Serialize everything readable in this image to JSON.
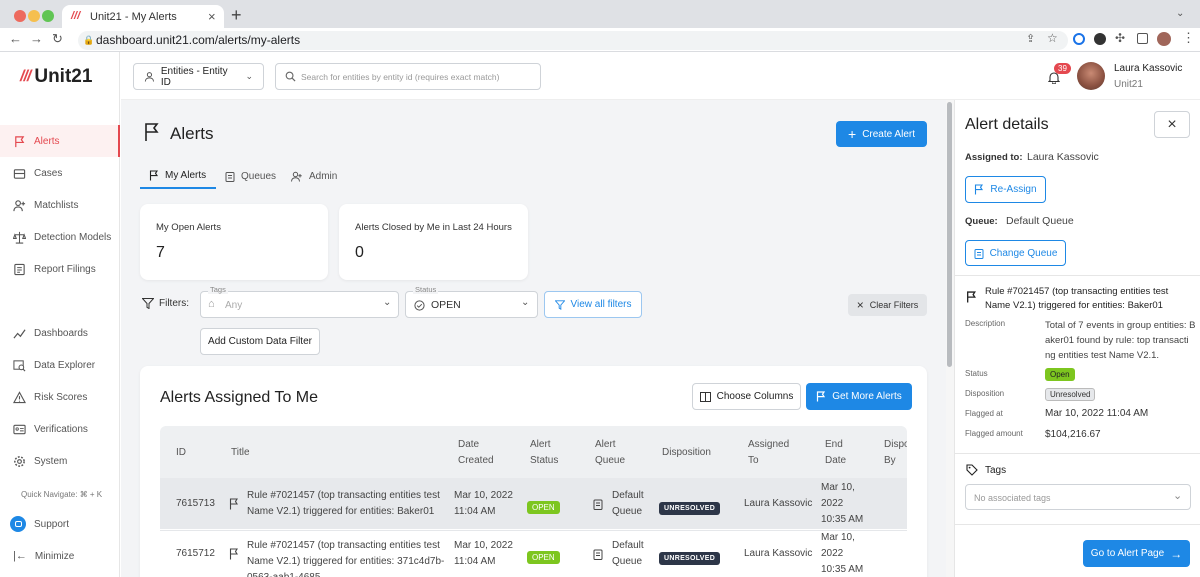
{
  "browser": {
    "tab_title": "Unit21 - My Alerts",
    "url": "dashboard.unit21.com/alerts/my-alerts",
    "colors": {
      "close": "#ed6a5e",
      "minimize": "#f5bf4f",
      "maximize": "#61c554"
    }
  },
  "brand": {
    "name": "Unit21",
    "accent": "#e4484f"
  },
  "sidebar": {
    "items": [
      {
        "label": "Alerts",
        "icon": "flag-icon"
      },
      {
        "label": "Cases",
        "icon": "cases-icon"
      },
      {
        "label": "Matchlists",
        "icon": "user-plus-icon"
      },
      {
        "label": "Detection Models",
        "icon": "scale-icon"
      },
      {
        "label": "Report Filings",
        "icon": "report-icon"
      },
      {
        "label": "Dashboards",
        "icon": "chart-icon"
      },
      {
        "label": "Data Explorer",
        "icon": "data-explorer-icon"
      },
      {
        "label": "Risk Scores",
        "icon": "warning-icon"
      },
      {
        "label": "Verifications",
        "icon": "id-card-icon"
      },
      {
        "label": "System",
        "icon": "gear-icon"
      }
    ],
    "quick_navigate": "Quick Navigate: ⌘ + K",
    "support": "Support",
    "minimize": "Minimize"
  },
  "header": {
    "entity_select": "Entities - Entity ID",
    "search_placeholder": "Search for entities by entity id (requires exact match)",
    "notification_count": "39",
    "user_name": "Laura Kassovic",
    "user_org": "Unit21"
  },
  "page": {
    "title": "Alerts",
    "create_button": "Create Alert",
    "tabs": [
      {
        "label": "My Alerts"
      },
      {
        "label": "Queues"
      },
      {
        "label": "Admin"
      }
    ],
    "stats": [
      {
        "label": "My Open Alerts",
        "value": "7"
      },
      {
        "label": "Alerts Closed by Me in Last 24 Hours",
        "value": "0"
      }
    ],
    "filters": {
      "label": "Filters:",
      "tags_label": "Tags",
      "tags_placeholder": "Any",
      "status_label": "Status",
      "status_value": "OPEN",
      "view_all": "View all filters",
      "clear": "Clear Filters",
      "add_custom": "Add Custom Data Filter"
    }
  },
  "table": {
    "title": "Alerts Assigned To Me",
    "choose_columns": "Choose Columns",
    "get_more": "Get More Alerts",
    "headers": {
      "id": "ID",
      "title": "Title",
      "date_created": [
        "Date",
        "Created"
      ],
      "alert_status": [
        "Alert",
        "Status"
      ],
      "alert_queue": [
        "Alert",
        "Queue"
      ],
      "disposition": "Disposition",
      "assigned_to": [
        "Assigned",
        "To"
      ],
      "end_date": [
        "End",
        "Date"
      ],
      "disposed_by": [
        "Dispo",
        "By"
      ]
    },
    "rows": [
      {
        "id": "7615713",
        "title": [
          "Rule #7021457 (top transacting entities test",
          "Name V2.1) triggered for entities: Baker01"
        ],
        "date": [
          "Mar 10, 2022",
          "11:04 AM"
        ],
        "status": "OPEN",
        "queue": [
          "Default",
          "Queue"
        ],
        "disposition": "UNRESOLVED",
        "assigned": "Laura Kassovic",
        "end_date": [
          "Mar 10,",
          "2022",
          "10:35 AM"
        ]
      },
      {
        "id": "7615712",
        "title": [
          "Rule #7021457 (top transacting entities test",
          "Name V2.1) triggered for entities: 371c4d7b-",
          "0563-aab1-4685"
        ],
        "date": [
          "Mar 10, 2022",
          "11:04 AM"
        ],
        "status": "OPEN",
        "queue": [
          "Default",
          "Queue"
        ],
        "disposition": "UNRESOLVED",
        "assigned": "Laura Kassovic",
        "end_date": [
          "Mar 10,",
          "2022",
          "10:35 AM"
        ]
      }
    ]
  },
  "panel": {
    "title": "Alert details",
    "assigned_label": "Assigned to:",
    "assigned_value": "Laura Kassovic",
    "reassign": "Re-Assign",
    "queue_label": "Queue:",
    "queue_value": "Default Queue",
    "change_queue": "Change Queue",
    "rule_title": [
      "Rule #7021457 (top transacting entities test",
      "Name V2.1) triggered for entities: Baker01"
    ],
    "description_label": "Description",
    "description": [
      "Total of 7 events in group entities: B",
      "aker01 found by rule: top transacti",
      "ng entities test Name V2.1."
    ],
    "status_label": "Status",
    "status_value": "Open",
    "disposition_label": "Disposition",
    "disposition_value": "Unresolved",
    "flagged_at_label": "Flagged at",
    "flagged_at_value": "Mar 10, 2022 11:04 AM",
    "flagged_amount_label": "Flagged amount",
    "flagged_amount_value": "$104,216.67",
    "tags_title": "Tags",
    "tags_placeholder": "No associated tags",
    "go_to_alert": "Go to Alert Page"
  }
}
